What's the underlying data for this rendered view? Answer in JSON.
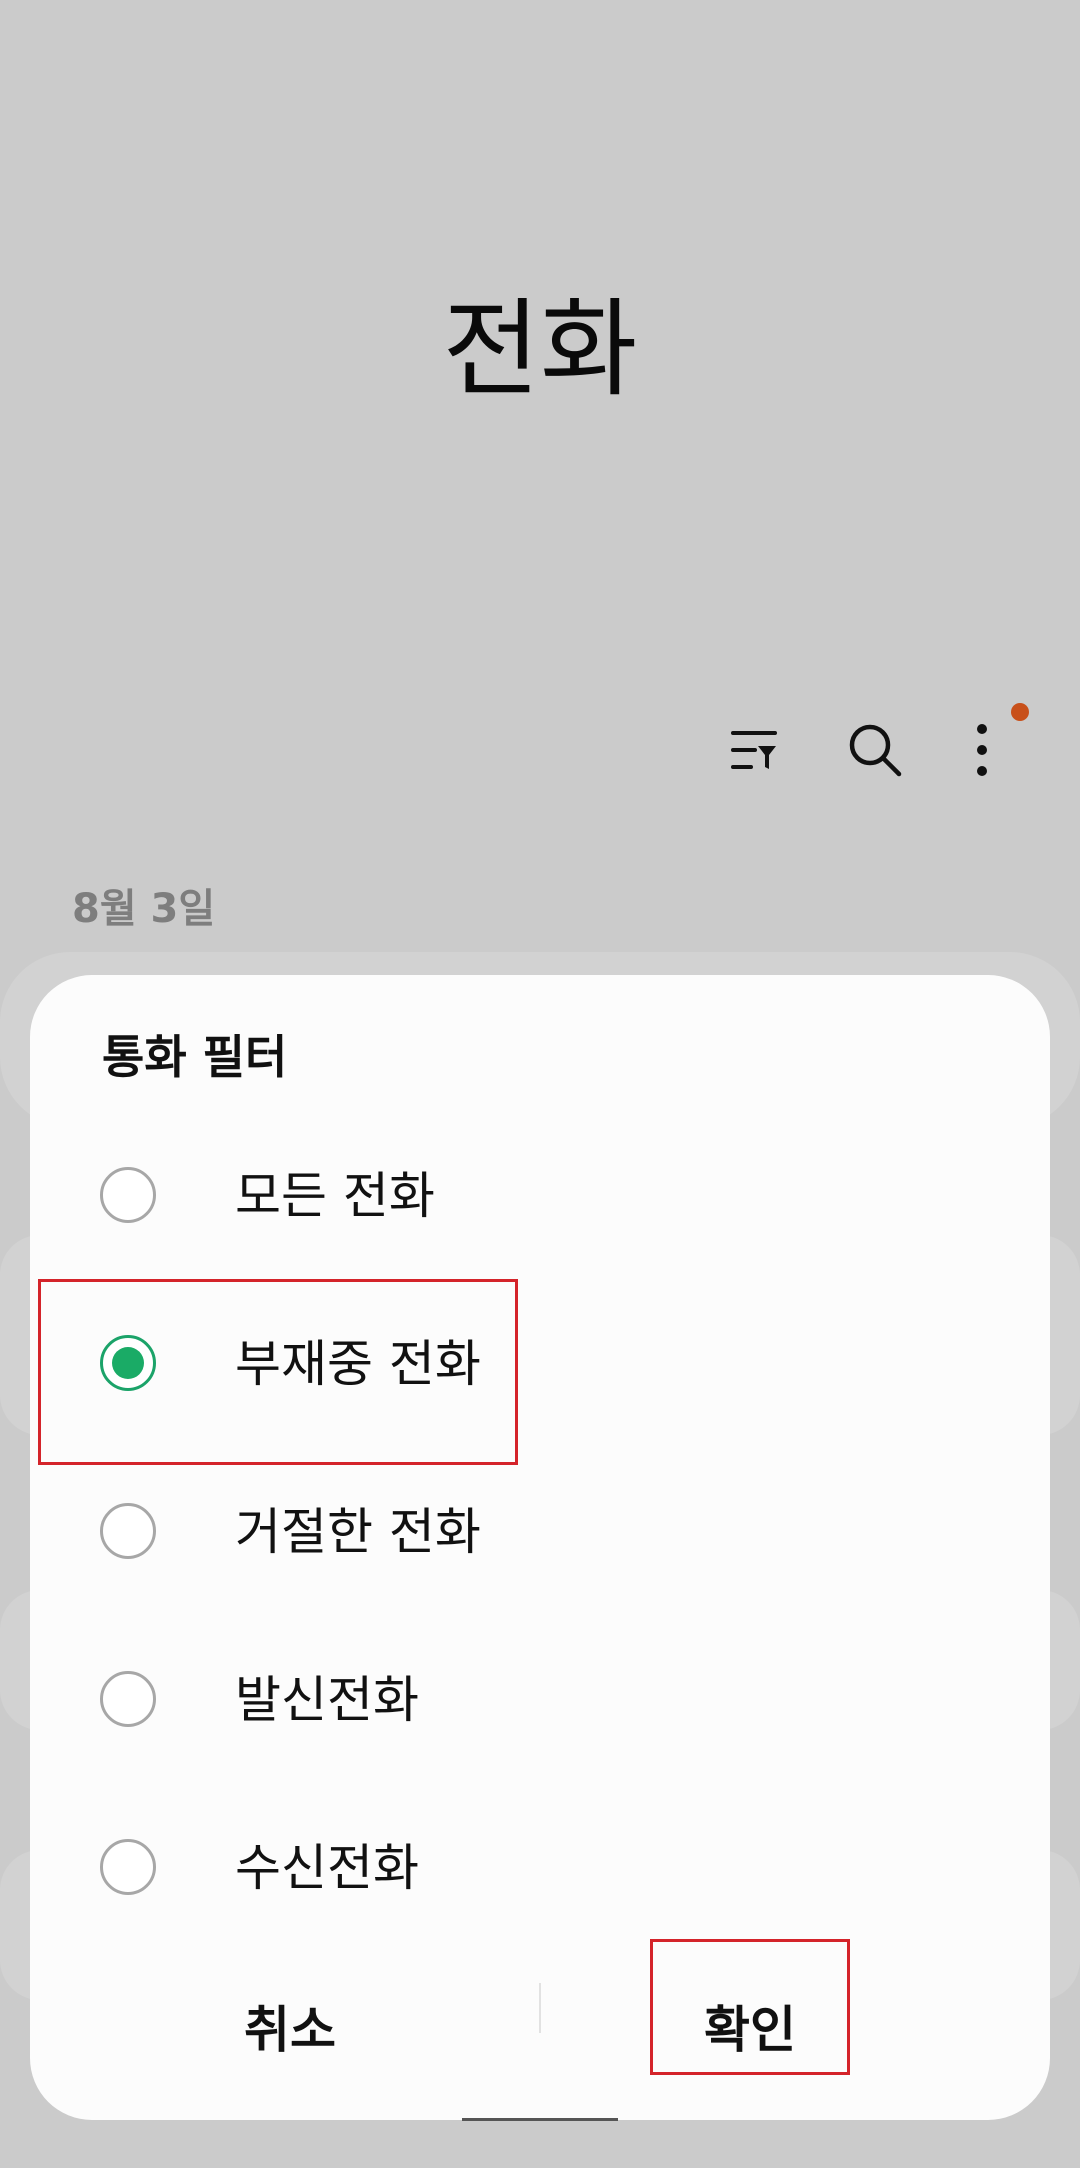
{
  "header": {
    "title": "전화"
  },
  "toolbar": {
    "filter_icon": "filter-list-icon",
    "search_icon": "search-icon",
    "more_icon": "more-vertical-icon",
    "notification_color": "#c8501a"
  },
  "list": {
    "date_header": "8월 3일"
  },
  "dialog": {
    "title": "통화 필터",
    "options": [
      {
        "label": "모든 전화",
        "selected": false
      },
      {
        "label": "부재중 전화",
        "selected": true
      },
      {
        "label": "거절한 전화",
        "selected": false
      },
      {
        "label": "발신전화",
        "selected": false
      },
      {
        "label": "수신전화",
        "selected": false
      }
    ],
    "cancel_label": "취소",
    "confirm_label": "확인",
    "accent_color": "#1aab66",
    "highlight_color": "#d4242a"
  }
}
